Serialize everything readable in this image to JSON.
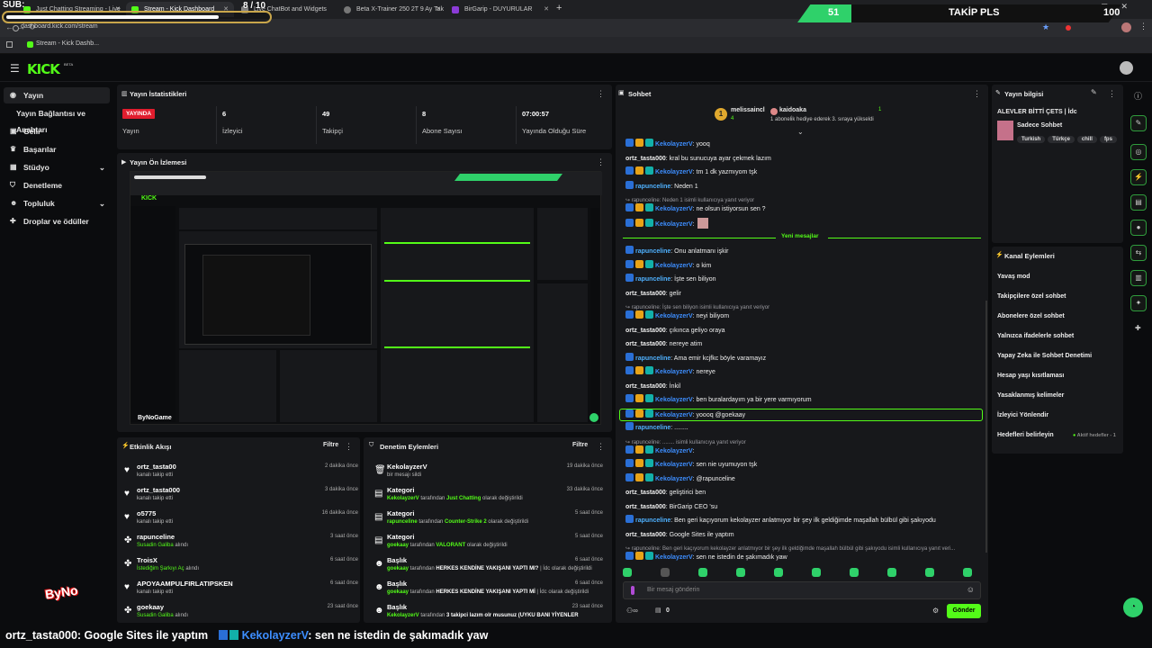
{
  "browser": {
    "tabs": [
      {
        "label": "Just Chatting Streaming - Live"
      },
      {
        "label": "Stream - Kick Dashboard"
      },
      {
        "label": "Live ChatBot and Widgets"
      },
      {
        "label": "Beta X-Trainer 250 2T 9 Ay Tak"
      },
      {
        "label": "BirGarip - DUYURULAR"
      }
    ],
    "url": "dashboard.kick.com/stream",
    "bookmark": "Stream - Kick Dashb..."
  },
  "overlay": {
    "sub_label": "SUB:",
    "sub_count": "8 / 10",
    "goal_left": "51",
    "goal_label": "TAKİP PLS",
    "goal_right": "100",
    "ticker": [
      {
        "user": "ortz_tasta000",
        "text": ": Google Sites ile yaptım"
      },
      {
        "user": "KekolayzerV",
        "text": ": sen ne istedin de şakımadık yaw"
      }
    ],
    "streamer_tag": "ByNo"
  },
  "app": {
    "logo": "KICK",
    "beta": "BETA"
  },
  "sidebar": {
    "items": [
      {
        "label": "Yayın",
        "icon": "broadcast-icon"
      },
      {
        "label": "Yayın Bağlantısı ve Anahtarı",
        "icon": ""
      },
      {
        "label": "Gelir",
        "icon": "wallet-icon"
      },
      {
        "label": "Başarılar",
        "icon": "trophy-icon"
      },
      {
        "label": "Stüdyo",
        "icon": "studio-icon"
      },
      {
        "label": "Denetleme",
        "icon": "shield-icon"
      },
      {
        "label": "Topluluk",
        "icon": "community-icon"
      },
      {
        "label": "Droplar ve ödüller",
        "icon": "gift-icon"
      }
    ]
  },
  "stats": {
    "title": "Yayın İstatistikleri",
    "live_badge": "YAYINDA",
    "items": [
      {
        "value": "",
        "label": "Yayın"
      },
      {
        "value": "6",
        "label": "İzleyici"
      },
      {
        "value": "49",
        "label": "Takipçi"
      },
      {
        "value": "8",
        "label": "Abone Sayısı"
      },
      {
        "value": "07:00:57",
        "label": "Yayında Olduğu Süre"
      }
    ]
  },
  "preview": {
    "title": "Yayın Ön İzlemesi",
    "watermark": "ByNoGame"
  },
  "activity": {
    "title": "Etkinlik Akışı",
    "filter": "Filtre",
    "items": [
      {
        "name": "ortz_tasta00",
        "sub": "kanalı takip etti",
        "time": "2 dakika önce"
      },
      {
        "name": "ortz_tasta000",
        "sub": "kanalı takip etti",
        "time": "3 dakika önce"
      },
      {
        "name": "o5775",
        "sub": "kanalı takip etti",
        "time": "16 dakika önce"
      },
      {
        "name": "rapunceline",
        "sub": "Susadin Galiba",
        "sub2": " alındı",
        "time": "3 saat önce"
      },
      {
        "name": "TroisX",
        "sub": "İstediğim Şarkıyı Aç",
        "sub2": " alındı",
        "time": "6 saat önce"
      },
      {
        "name": "APOYAAMPULFIRLATIPSKEN",
        "sub": "kanalı takip etti",
        "time": "6 saat önce"
      },
      {
        "name": "goekaay",
        "sub": "Susadin Galiba",
        "sub2": " alındı",
        "time": "23 saat önce"
      }
    ]
  },
  "moderation": {
    "title": "Denetim Eylemleri",
    "filter": "Filtre",
    "items": [
      {
        "name": "KekolayzerV",
        "sub": "bir mesajı sildi",
        "time": "19 dakika önce"
      },
      {
        "name": "Kategori",
        "user": "KekolayzerV",
        "mid": " tarafından ",
        "hl": "Just Chatting",
        "end": " olarak değiştirildi",
        "time": "33 dakika önce"
      },
      {
        "name": "Kategori",
        "user": "rapunceline",
        "mid": " tarafından ",
        "hl": "Counter-Strike 2",
        "end": " olarak değiştirildi",
        "time": "5 saat önce"
      },
      {
        "name": "Kategori",
        "user": "goekaay",
        "mid": " tarafından ",
        "hl": "VALORANT",
        "end": " olarak değiştirildi",
        "time": "5 saat önce"
      },
      {
        "name": "Başlık",
        "user": "goekaay",
        "mid": " tarafından ",
        "hl": "HERKES KENDİNE YAKIŞANI YAPTI MI?",
        "end": " | İdc olarak değiştirildi",
        "time": "6 saat önce"
      },
      {
        "name": "Başlık",
        "user": "goekaay",
        "mid": " tarafından ",
        "hl": "HERKES KENDİNE YAKIŞANI YAPTI Mİ",
        "end": " | İdc olarak değiştirildi",
        "time": "6 saat önce"
      },
      {
        "name": "Başlık",
        "user": "KekolayzerV",
        "mid": " tarafından ",
        "hl": "3 takipci lazım olr musunuz (UYKU BANI YİYENLER",
        "end": "",
        "time": "23 saat önce"
      }
    ]
  },
  "chat": {
    "title": "Sohbet",
    "pinned": {
      "user1": "melissaincl",
      "count1": "4",
      "user2": "kaidoaka",
      "text": "1 aboneli̇k hediye ederek 3. sıraya yükseldi",
      "count2": "1"
    },
    "new_messages": "Yeni mesajlar",
    "messages": [
      {
        "kind": "badge",
        "user": "KekolayzerV",
        "text": ": yooq"
      },
      {
        "kind": "plain",
        "user": "ortz_tasta000",
        "text": ": kral bu sunucuya ayar çekmek lazım"
      },
      {
        "kind": "badge",
        "user": "KekolayzerV",
        "text": ": tm 1 dk yazmıyom tşk"
      },
      {
        "kind": "one",
        "user": "rapunceline",
        "text": ": Neden 1"
      },
      {
        "kind": "reply",
        "text": "rapunceline: Neden 1 isimli kullanıcıya yanıt veriyor"
      },
      {
        "kind": "badge",
        "user": "KekolayzerV",
        "text": ": ne olsun istiyorsun sen ?"
      },
      {
        "kind": "badge",
        "user": "KekolayzerV",
        "text": ":"
      },
      {
        "kind": "one",
        "user": "rapunceline",
        "text": ": Onu anlatmanı işkir"
      },
      {
        "kind": "badge",
        "user": "KekolayzerV",
        "text": ": o kim"
      },
      {
        "kind": "one",
        "user": "rapunceline",
        "text": ": İşte sen biliyon"
      },
      {
        "kind": "plain",
        "user": "ortz_tasta000",
        "text": ": gelir"
      },
      {
        "kind": "reply",
        "text": "rapunceline: İşte sen biliyon isimli kullanıcıya yanıt veriyor"
      },
      {
        "kind": "badge",
        "user": "KekolayzerV",
        "text": ": neyi biliyom"
      },
      {
        "kind": "plain",
        "user": "ortz_tasta000",
        "text": ": çıkınca geliyo oraya"
      },
      {
        "kind": "plain",
        "user": "ortz_tasta000",
        "text": ": nereye atim"
      },
      {
        "kind": "one",
        "user": "rapunceline",
        "text": ": Ama emir kcjfkc böyle varamayız"
      },
      {
        "kind": "badge",
        "user": "KekolayzerV",
        "text": ": nereye"
      },
      {
        "kind": "plain",
        "user": "ortz_tasta000",
        "text": ": İnkil"
      },
      {
        "kind": "badge",
        "user": "KekolayzerV",
        "text": ": ben buralardayım ya bir yere varmıyorum"
      },
      {
        "kind": "badge",
        "user": "KekolayzerV",
        "text": ": yoooq @goekaay",
        "hl": true
      },
      {
        "kind": "one",
        "user": "rapunceline",
        "text": ": ........"
      },
      {
        "kind": "reply",
        "text": "rapunceline: ........ isimli kullanıcıya yanıt veriyor"
      },
      {
        "kind": "badge",
        "user": "KekolayzerV",
        "text": ":"
      },
      {
        "kind": "badge",
        "user": "KekolayzerV",
        "text": ": sen nie uyumuyon tşk"
      },
      {
        "kind": "badge",
        "user": "KekolayzerV",
        "text": ": @rapunceline"
      },
      {
        "kind": "plain",
        "user": "ortz_tasta000",
        "text": ": geliştirici ben"
      },
      {
        "kind": "plain",
        "user": "ortz_tasta000",
        "text": ": BirGarip CEO 'su"
      },
      {
        "kind": "one",
        "user": "rapunceline",
        "text": ": Ben geri kaçıyorum kekolayzer anlatmıyor bir şey ilk geldiğimde maşallah bülbül gibi şakıyodu"
      },
      {
        "kind": "plain",
        "user": "ortz_tasta000",
        "text": ": Google Sites ile yaptım"
      },
      {
        "kind": "reply",
        "text": "rapunceline: Ben geri kaçıyorum kekolayzer anlatmıyor bir şey ilk geldiğimde maşallah bülbül gibi şakıyodu isimli kullanıcıya yanıt veri..."
      },
      {
        "kind": "badge",
        "user": "KekolayzerV",
        "text": ": sen ne istedin de şakımadık yaw"
      }
    ],
    "input_placeholder": "Bir mesaj gönderin",
    "points": "0",
    "send": "Gönder"
  },
  "info": {
    "title": "Yayın bilgisi",
    "stream_title": "ALEVLER BİTTİ ÇETS | İdc",
    "category": "Sadece Sohbet",
    "tags": [
      "Turkish",
      "Türkçe",
      "chill",
      "fps"
    ]
  },
  "actions": {
    "title": "Kanal Eylemleri",
    "items": [
      {
        "label": "Yavaş mod",
        "ctrl": "arrow"
      },
      {
        "label": "Takipçilere özel sohbet",
        "ctrl": "arrow"
      },
      {
        "label": "Abonelere özel sohbet",
        "ctrl": "toggle"
      },
      {
        "label": "Yalnızca ifadelerle sohbet",
        "ctrl": "toggle"
      },
      {
        "label": "Yapay Zeka ile Sohbet Denetimi",
        "ctrl": "link"
      },
      {
        "label": "Hesap yaşı kısıtlaması",
        "ctrl": "arrow"
      },
      {
        "label": "Yasaklanmış kelimeler",
        "ctrl": "arrow"
      },
      {
        "label": "İzleyici Yönlendir",
        "ctrl": "none"
      },
      {
        "label": "Hedefleri belirleyin",
        "ctrl": "arrow",
        "extra": "Aktif hedefler - 1"
      }
    ]
  }
}
